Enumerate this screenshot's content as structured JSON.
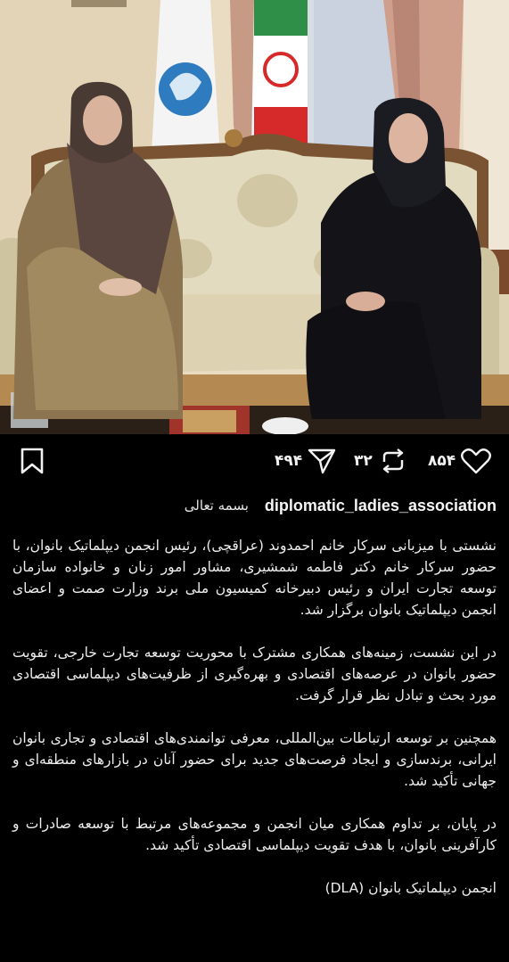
{
  "post": {
    "likes": "۸۵۴",
    "reposts": "۳۲",
    "shares": "۴۹۴"
  },
  "icons": {
    "like": "heart-icon",
    "repost": "repost-icon",
    "share": "paper-plane-icon",
    "save": "bookmark-icon"
  },
  "caption": {
    "username": "diplomatic_ladies_association",
    "opening": "بسمه تعالی",
    "p1": "نشستی با میزبانی سرکار خانم احمدوند (عراقچی)، رئیس انجمن دیپلماتیک بانوان، با حضور سرکار خانم دکتر فاطمه شمشیری، مشاور امور زنان و خانواده سازمان توسعه تجارت ایران و رئیس دبیرخانه کمیسیون ملی برند وزارت صمت و اعضای انجمن دیپلماتیک بانوان برگزار شد.",
    "p2": "در این نشست، زمینه‌های همکاری مشترک با محوریت توسعه تجارت خارجی، تقویت حضور بانوان در عرصه‌های اقتصادی و بهره‌گیری از ظرفیت‌های دیپلماسی اقتصادی مورد بحث و تبادل نظر قرار گرفت.",
    "p3": "همچنین بر توسعه ارتباطات بین‌المللی، معرفی توانمندی‌های اقتصادی و تجاری بانوان ایرانی، برندسازی و ایجاد فرصت‌های جدید برای حضور آنان در بازارهای منطقه‌ای و جهانی تأکید شد.",
    "p4": "در پایان، بر تداوم همکاری میان انجمن و مجموعه‌های مرتبط با توسعه صادرات و کارآفرینی بانوان، با هدف تقویت دیپلماسی اقتصادی تأکید شد.",
    "signature": "انجمن دیپلماتیک بانوان (DLA)"
  },
  "colors": {
    "background": "#000000",
    "text": "#eeeeee"
  }
}
